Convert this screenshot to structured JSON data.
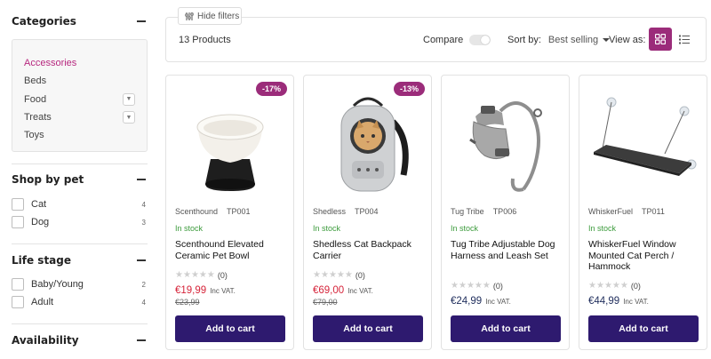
{
  "sidebar": {
    "categories": {
      "title": "Categories",
      "items": [
        {
          "label": "Accessories",
          "active": true,
          "expand": false
        },
        {
          "label": "Beds",
          "active": false,
          "expand": false
        },
        {
          "label": "Food",
          "active": false,
          "expand": true
        },
        {
          "label": "Treats",
          "active": false,
          "expand": true
        },
        {
          "label": "Toys",
          "active": false,
          "expand": false
        }
      ]
    },
    "shop_by_pet": {
      "title": "Shop by pet",
      "options": [
        {
          "label": "Cat",
          "count": "4"
        },
        {
          "label": "Dog",
          "count": "3"
        }
      ]
    },
    "life_stage": {
      "title": "Life stage",
      "options": [
        {
          "label": "Baby/Young",
          "count": "2"
        },
        {
          "label": "Adult",
          "count": "4"
        }
      ]
    },
    "availability": {
      "title": "Availability"
    }
  },
  "toolbar": {
    "hide_filters": "Hide filters",
    "product_count": "13 Products",
    "compare_label": "Compare",
    "sort_label": "Sort by:",
    "sort_value": "Best selling",
    "view_label": "View as:"
  },
  "products": [
    {
      "badge": "-17%",
      "brand": "Scenthound",
      "sku": "TP001",
      "stock": "In stock",
      "name": "Scenthound Elevated Ceramic Pet Bowl",
      "rating_count": "(0)",
      "price": "€19,99",
      "vat": "Inc VAT.",
      "old_price": "€23,99",
      "cart": "Add to cart"
    },
    {
      "badge": "-13%",
      "brand": "Shedless",
      "sku": "TP004",
      "stock": "In stock",
      "name": "Shedless Cat Backpack Carrier",
      "rating_count": "(0)",
      "price": "€69,00",
      "vat": "Inc VAT.",
      "old_price": "€79,00",
      "cart": "Add to cart"
    },
    {
      "brand": "Tug Tribe",
      "sku": "TP006",
      "stock": "In stock",
      "name": "Tug Tribe Adjustable Dog Harness and Leash Set",
      "rating_count": "(0)",
      "price": "€24,99",
      "vat": "Inc VAT.",
      "cart": "Add to cart"
    },
    {
      "brand": "WhiskerFuel",
      "sku": "TP011",
      "stock": "In stock",
      "name": "WhiskerFuel Window Mounted Cat Perch / Hammock",
      "rating_count": "(0)",
      "price": "€44,99",
      "vat": "Inc VAT.",
      "cart": "Add to cart"
    }
  ],
  "colors": {
    "accent": "#9b2c7a",
    "button": "#2e1a6f",
    "sale_price": "#d6243a",
    "price": "#1f2d5c",
    "in_stock": "#3c9b3c"
  }
}
